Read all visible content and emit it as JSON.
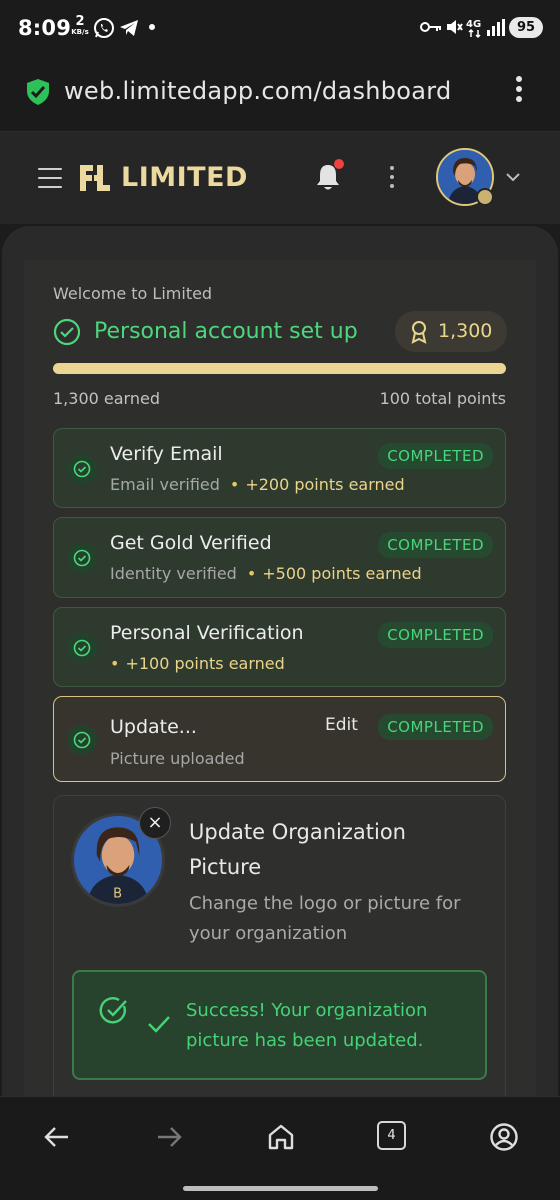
{
  "status_bar": {
    "time": "8:09",
    "net_speed_value": "2",
    "net_speed_unit": "KB/s",
    "battery": "95"
  },
  "browser": {
    "url": "web.limitedapp.com/dashboard",
    "tabs_count": "4"
  },
  "header": {
    "brand": "LIMITED",
    "brand_color": "#ecd9a0"
  },
  "onboarding": {
    "welcome": "Welcome to Limited",
    "title": "Personal account set up",
    "points": "1,300",
    "progress_fraction": 1.0,
    "earned_label": "1,300 earned",
    "total_label": "100 total points"
  },
  "tasks": [
    {
      "title": "Verify Email",
      "subtitle": "Email verified",
      "points": "+200 points earned",
      "status": "COMPLETED"
    },
    {
      "title": "Get Gold Verified",
      "subtitle": "Identity verified",
      "points": "+500 points earned",
      "status": "COMPLETED"
    },
    {
      "title": "Personal Verification",
      "subtitle": "",
      "points": "+100 points earned",
      "status": "COMPLETED"
    },
    {
      "title": "Update...",
      "subtitle": "Picture uploaded",
      "edit_label": "Edit",
      "status": "COMPLETED"
    }
  ],
  "org_picture": {
    "title": "Update Organization Picture",
    "description": "Change the logo or picture for your organization",
    "success_message": "Success! Your organization picture has been updated.",
    "close_symbol": "×"
  },
  "colors": {
    "success_green": "#4cd77c",
    "gold": "#ead593"
  }
}
